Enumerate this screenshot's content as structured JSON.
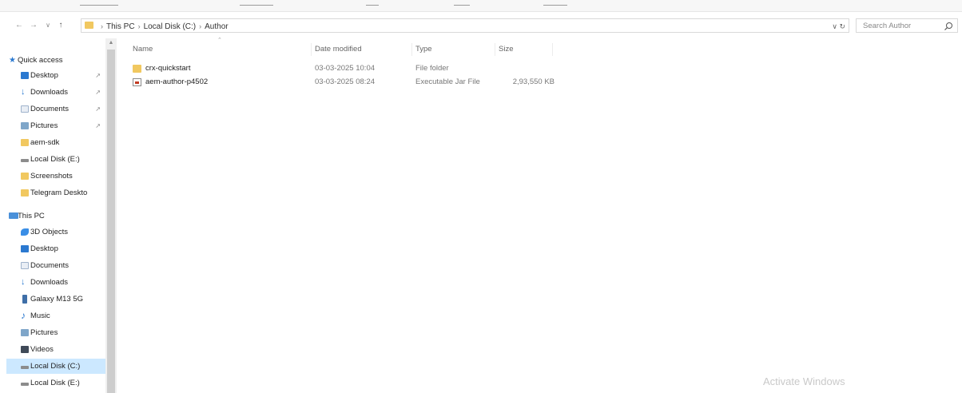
{
  "address_bar": {
    "breadcrumbs": [
      "This PC",
      "Local Disk (C:)",
      "Author"
    ],
    "refresh_glyph": "∨ ↻"
  },
  "search": {
    "placeholder": "Search Author"
  },
  "sidebar": {
    "items": [
      {
        "label": "Quick access",
        "icon": "star-icon",
        "level": 0,
        "pinned": false
      },
      {
        "label": "Desktop",
        "icon": "desktop-icon",
        "level": 1,
        "pinned": true
      },
      {
        "label": "Downloads",
        "icon": "download-icon",
        "level": 1,
        "pinned": true
      },
      {
        "label": "Documents",
        "icon": "document-icon",
        "level": 1,
        "pinned": true
      },
      {
        "label": "Pictures",
        "icon": "picture-icon",
        "level": 1,
        "pinned": true
      },
      {
        "label": "aem-sdk",
        "icon": "folder-icon",
        "level": 1,
        "pinned": false
      },
      {
        "label": "Local Disk (E:)",
        "icon": "drive-icon",
        "level": 1,
        "pinned": false
      },
      {
        "label": "Screenshots",
        "icon": "folder-icon",
        "level": 1,
        "pinned": false
      },
      {
        "label": "Telegram Deskto",
        "icon": "folder-icon",
        "level": 1,
        "pinned": false
      },
      {
        "label": "This PC",
        "icon": "computer-icon",
        "level": 0,
        "pinned": false
      },
      {
        "label": "3D Objects",
        "icon": "cube-icon",
        "level": 1,
        "pinned": false
      },
      {
        "label": "Desktop",
        "icon": "desktop-icon",
        "level": 1,
        "pinned": false
      },
      {
        "label": "Documents",
        "icon": "document-icon",
        "level": 1,
        "pinned": false
      },
      {
        "label": "Downloads",
        "icon": "download-icon",
        "level": 1,
        "pinned": false
      },
      {
        "label": "Galaxy M13 5G",
        "icon": "phone-icon",
        "level": 1,
        "pinned": false
      },
      {
        "label": "Music",
        "icon": "music-icon",
        "level": 1,
        "pinned": false
      },
      {
        "label": "Pictures",
        "icon": "picture-icon",
        "level": 1,
        "pinned": false
      },
      {
        "label": "Videos",
        "icon": "video-icon",
        "level": 1,
        "pinned": false
      },
      {
        "label": "Local Disk (C:)",
        "icon": "drive-icon",
        "level": 1,
        "pinned": false,
        "selected": true
      },
      {
        "label": "Local Disk (E:)",
        "icon": "drive-icon",
        "level": 1,
        "pinned": false
      }
    ]
  },
  "file_list": {
    "columns": [
      "Name",
      "Date modified",
      "Type",
      "Size"
    ],
    "rows": [
      {
        "name": "crx-quickstart",
        "date": "03-03-2025 10:04",
        "type": "File folder",
        "size": "",
        "icon": "folder-icon"
      },
      {
        "name": "aem-author-p4502",
        "date": "03-03-2025 08:24",
        "type": "Executable Jar File",
        "size": "2,93,550 KB",
        "icon": "jar-file-icon"
      }
    ]
  },
  "watermark": "Activate Windows",
  "colors": {
    "folder": "#f1c860",
    "selection": "#cce8ff",
    "accent_blue": "#2b79d0"
  }
}
